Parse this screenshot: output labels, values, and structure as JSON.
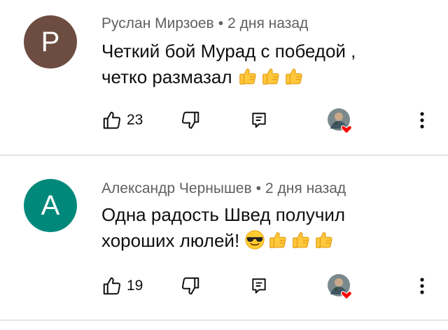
{
  "comments": [
    {
      "avatar_letter": "P",
      "avatar_color": "#6d4c41",
      "author": "Руслан Мирзоев",
      "separator": "•",
      "time": "2 дня назад",
      "text_line1": "Четкий бой Мурад с победой ,",
      "text_line2": "четко размазал",
      "emojis": [
        "thumbs-up",
        "thumbs-up",
        "thumbs-up"
      ],
      "likes": "23"
    },
    {
      "avatar_letter": "A",
      "avatar_color": "#00897b",
      "author": "Александр Чернышев",
      "separator": "•",
      "time": "2 дня назад",
      "text_line1": "Одна радость Швед получил",
      "text_line2": "хороших люлей!",
      "emojis": [
        "sunglasses-face",
        "thumbs-up",
        "thumbs-up",
        "thumbs-up"
      ],
      "likes": "19"
    }
  ],
  "icons": {
    "like": "like-icon",
    "dislike": "dislike-icon",
    "reply": "reply-icon",
    "creator_heart": "creator-heart-badge",
    "more": "more-vert-icon"
  },
  "colors": {
    "heart": "#ff0000",
    "meta_text": "#606060",
    "divider": "#e5e5e5"
  }
}
